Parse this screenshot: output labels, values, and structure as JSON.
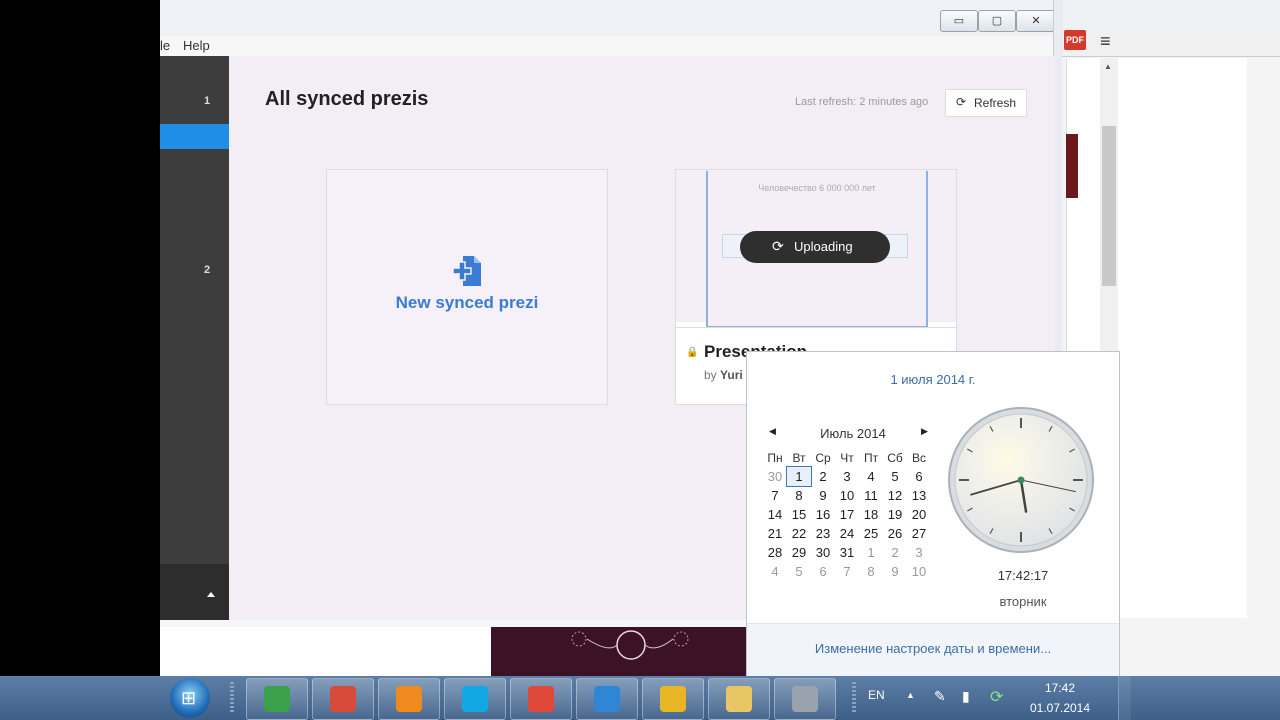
{
  "menubar": {
    "item_partial": "le",
    "help": "Help"
  },
  "window_controls": {
    "minimize": "▭",
    "maximize": "▢",
    "close": "✕"
  },
  "sidebar": {
    "items": [
      {
        "label": "1"
      },
      {
        "label": "2"
      }
    ]
  },
  "content": {
    "title": "All synced prezis",
    "last_refresh": "Last refresh: 2 minutes ago",
    "refresh_label": "Refresh",
    "new_card_label": "New synced prezi",
    "presentation": {
      "thumb_text": "Человечество 6 000 000 лет",
      "status": "Uploading",
      "title": "Presentation",
      "by_prefix": "by",
      "author": "Yuri"
    }
  },
  "calendar_popup": {
    "full_date": "1 июля 2014 г.",
    "month_label": "Июль 2014",
    "weekdays": [
      "Пн",
      "Вт",
      "Ср",
      "Чт",
      "Пт",
      "Сб",
      "Вс"
    ],
    "weeks": [
      [
        "30",
        "1",
        "2",
        "3",
        "4",
        "5",
        "6"
      ],
      [
        "7",
        "8",
        "9",
        "10",
        "11",
        "12",
        "13"
      ],
      [
        "14",
        "15",
        "16",
        "17",
        "18",
        "19",
        "20"
      ],
      [
        "21",
        "22",
        "23",
        "24",
        "25",
        "26",
        "27"
      ],
      [
        "28",
        "29",
        "30",
        "31",
        "1",
        "2",
        "3"
      ],
      [
        "4",
        "5",
        "6",
        "7",
        "8",
        "9",
        "10"
      ]
    ],
    "time": "17:42:17",
    "weekday": "вторник",
    "settings_link": "Изменение настроек даты и времени...",
    "clock_hands": {
      "hours": 17,
      "minutes": 42,
      "seconds": 17
    }
  },
  "taskbar": {
    "apps": [
      {
        "name": "Monitor",
        "color": "#3aa04a"
      },
      {
        "name": "Clock utility",
        "color": "#d84a3a"
      },
      {
        "name": "Settings",
        "color": "#f08a1c"
      },
      {
        "name": "Skype",
        "color": "#12a8e6"
      },
      {
        "name": "Git",
        "color": "#e0483a"
      },
      {
        "name": "Prezi",
        "color": "#2f86d6"
      },
      {
        "name": "Chrome",
        "color": "#e8b624"
      },
      {
        "name": "Explorer",
        "color": "#e9c664"
      },
      {
        "name": "Projector",
        "color": "#9aa3ad"
      }
    ],
    "lang": "EN",
    "time": "17:42",
    "date": "01.07.2014"
  },
  "background_browser": {
    "pdf_label": "PDF"
  }
}
